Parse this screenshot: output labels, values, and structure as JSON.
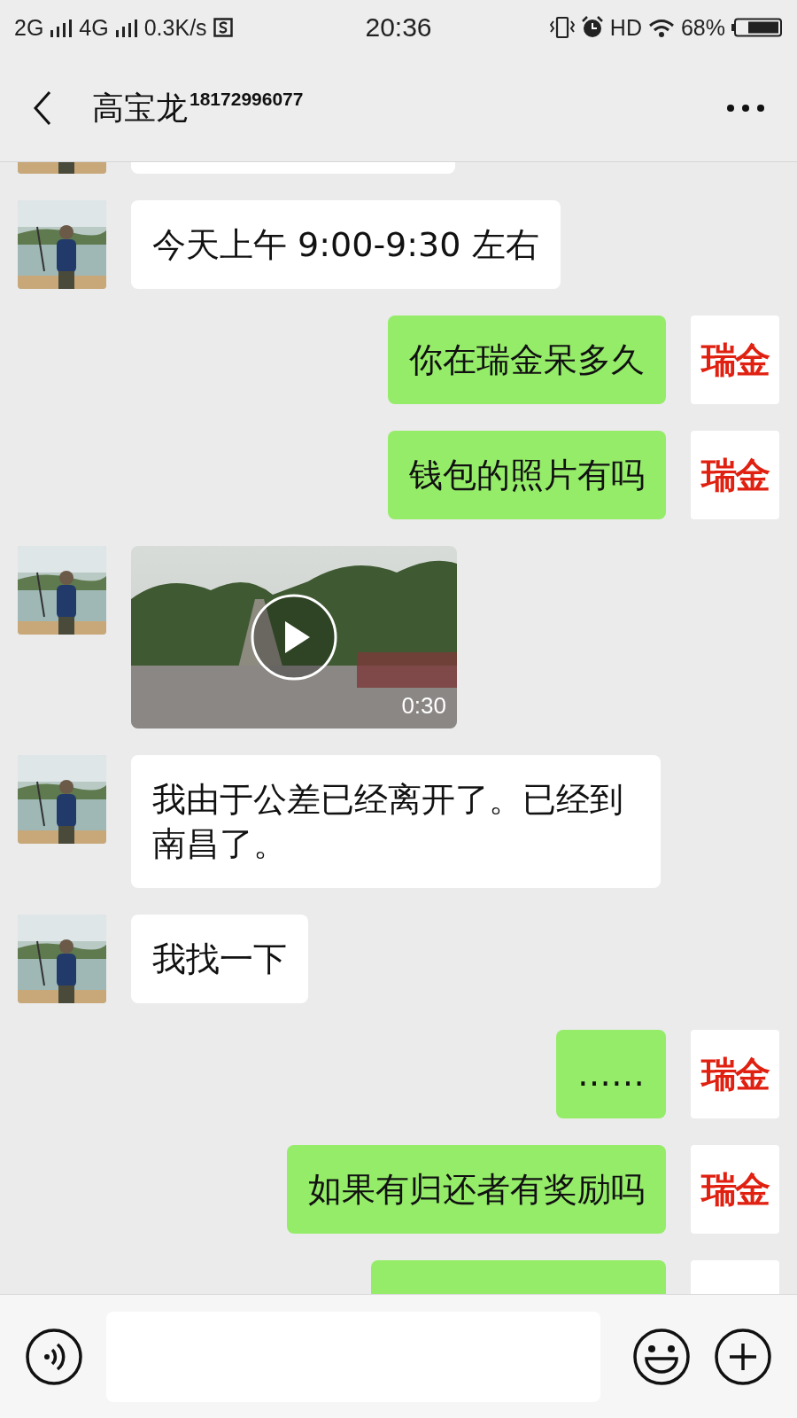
{
  "status_bar": {
    "network_1": "2G",
    "network_2": "4G",
    "speed": "0.3K/s",
    "time": "20:36",
    "hd": "HD",
    "battery": "68%"
  },
  "header": {
    "title": "高宝龙",
    "number": "18172996077"
  },
  "messages": [
    {
      "outgoing": false,
      "kind": "cut"
    },
    {
      "outgoing": false,
      "kind": "text",
      "text": "今天上午 9:00-9:30 左右"
    },
    {
      "outgoing": true,
      "kind": "text",
      "text": "你在瑞金呆多久",
      "avatar_text": "瑞金"
    },
    {
      "outgoing": true,
      "kind": "text",
      "text": "钱包的照片有吗",
      "avatar_text": "瑞金"
    },
    {
      "outgoing": false,
      "kind": "video",
      "duration": "0:30"
    },
    {
      "outgoing": false,
      "kind": "text",
      "text": "我由于公差已经离开了。已经到南昌了。"
    },
    {
      "outgoing": false,
      "kind": "text",
      "text": "我找一下"
    },
    {
      "outgoing": true,
      "kind": "text",
      "text": "……",
      "avatar_text": "瑞金"
    },
    {
      "outgoing": true,
      "kind": "text",
      "text": "如果有归还者有奖励吗",
      "avatar_text": "瑞金"
    },
    {
      "outgoing": true,
      "kind": "cut"
    }
  ]
}
